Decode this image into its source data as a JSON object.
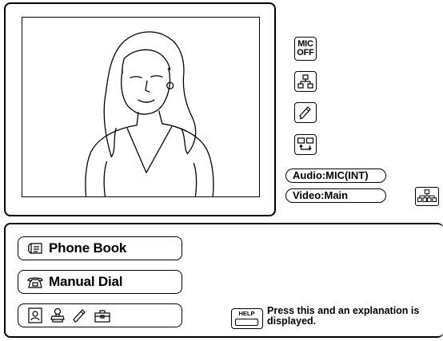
{
  "side_buttons": {
    "mic_off_line1": "MIC",
    "mic_off_line2": "OFF",
    "network_icon": "network-tree-icon",
    "pen_icon": "pen-icon",
    "screen_swap_icon": "screen-swap-icon"
  },
  "status": {
    "audio": "Audio:MIC(INT)",
    "video": "Video:Main"
  },
  "menu": {
    "phone_book_label": "Phone Book",
    "manual_dial_label": "Manual Dial",
    "tray_icons": [
      "contact-card-icon",
      "rubber-stamp-icon",
      "pen-icon",
      "toolbox-icon"
    ]
  },
  "help": {
    "key_label": "HELP",
    "text_line1": "Press this and an explanation is",
    "text_line2": "displayed."
  },
  "colors": {
    "foreground": "#000000",
    "background": "#ffffff"
  }
}
